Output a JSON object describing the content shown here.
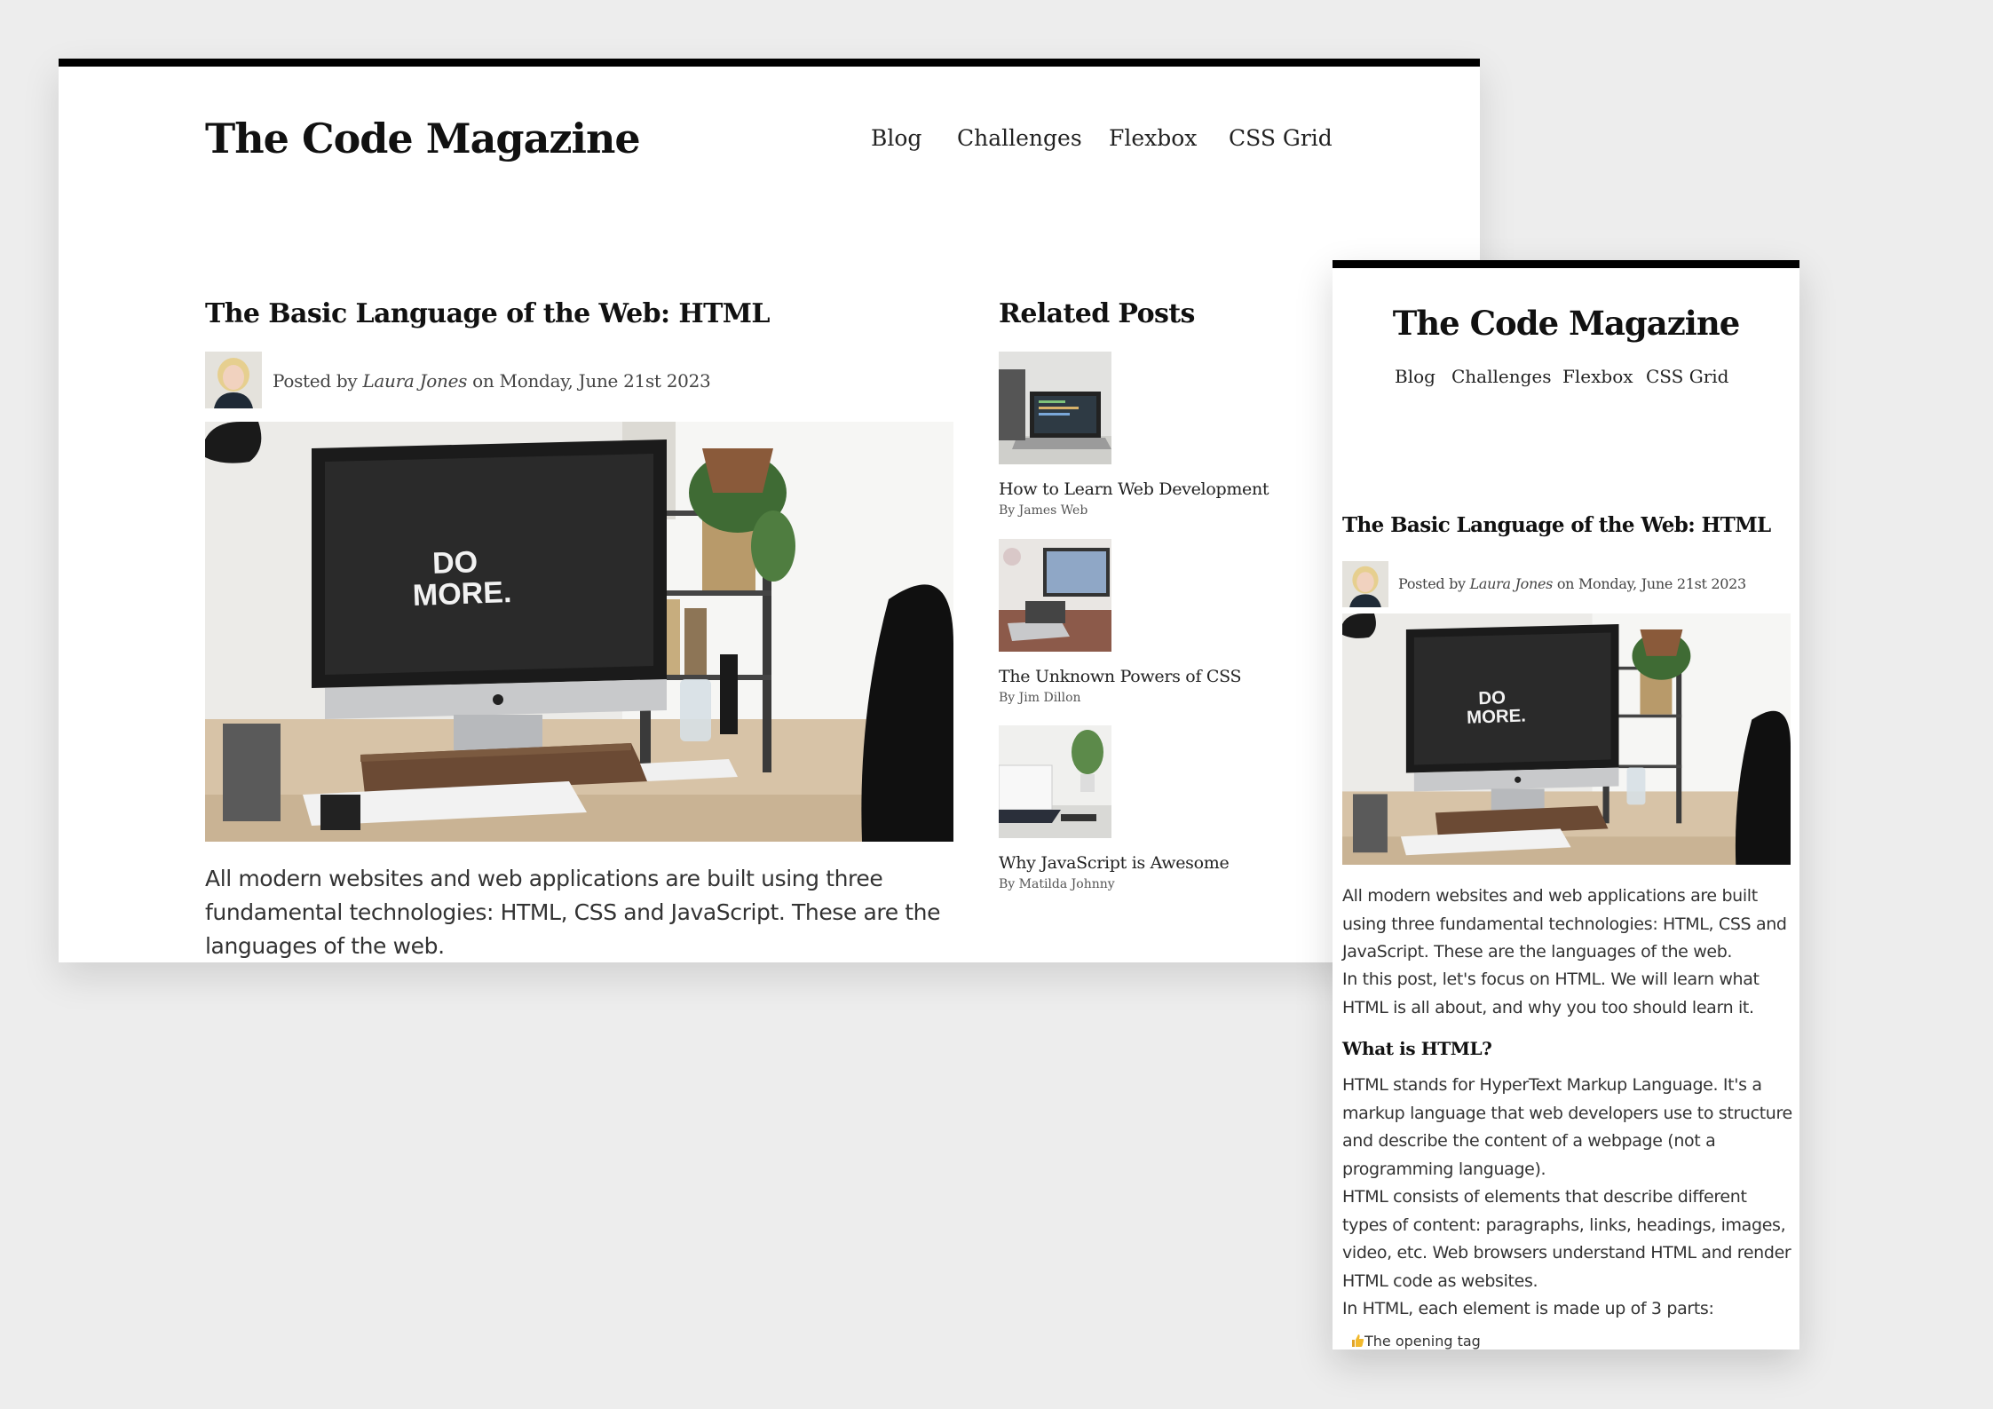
{
  "site": {
    "logo": "The Code Magazine",
    "nav": [
      "Blog",
      "Challenges",
      "Flexbox",
      "CSS Grid"
    ]
  },
  "post": {
    "title": "The Basic Language of the Web: HTML",
    "byline_prefix": "Posted by ",
    "author": "Laura Jones",
    "byline_suffix": " on Monday, June 21st 2023",
    "hero_text": [
      "DO",
      "MORE."
    ],
    "intro": "All modern websites and web applications are built using three fundamental technologies: HTML, CSS and JavaScript. These are the languages of the web.",
    "intro_2": "In this post, let's focus on HTML. We will learn what HTML is all about, and why you too should learn it.",
    "section_heading": "What is HTML?",
    "section_p1": "HTML stands for HyperText Markup Language. It's a markup language that web developers use to structure and describe the content of a webpage (not a programming language).",
    "section_p2": "HTML consists of elements that describe different types of content: paragraphs, links, headings, images, video, etc. Web browsers understand HTML and render HTML code as websites.",
    "section_p3": "In HTML, each element is made up of 3 parts:",
    "list_first": "The opening tag",
    "list_icon": "thumbs-up-icon"
  },
  "related": {
    "title": "Related Posts",
    "items": [
      {
        "title": "How to Learn Web Development",
        "author": "By James Web"
      },
      {
        "title": "The Unknown Powers of CSS",
        "author": "By Jim Dillon"
      },
      {
        "title": "Why JavaScript is Awesome",
        "author": "By Matilda Johnny"
      }
    ]
  },
  "colors": {
    "background": "#ededed",
    "page": "#ffffff",
    "topbar": "#000000",
    "text": "#111111"
  }
}
